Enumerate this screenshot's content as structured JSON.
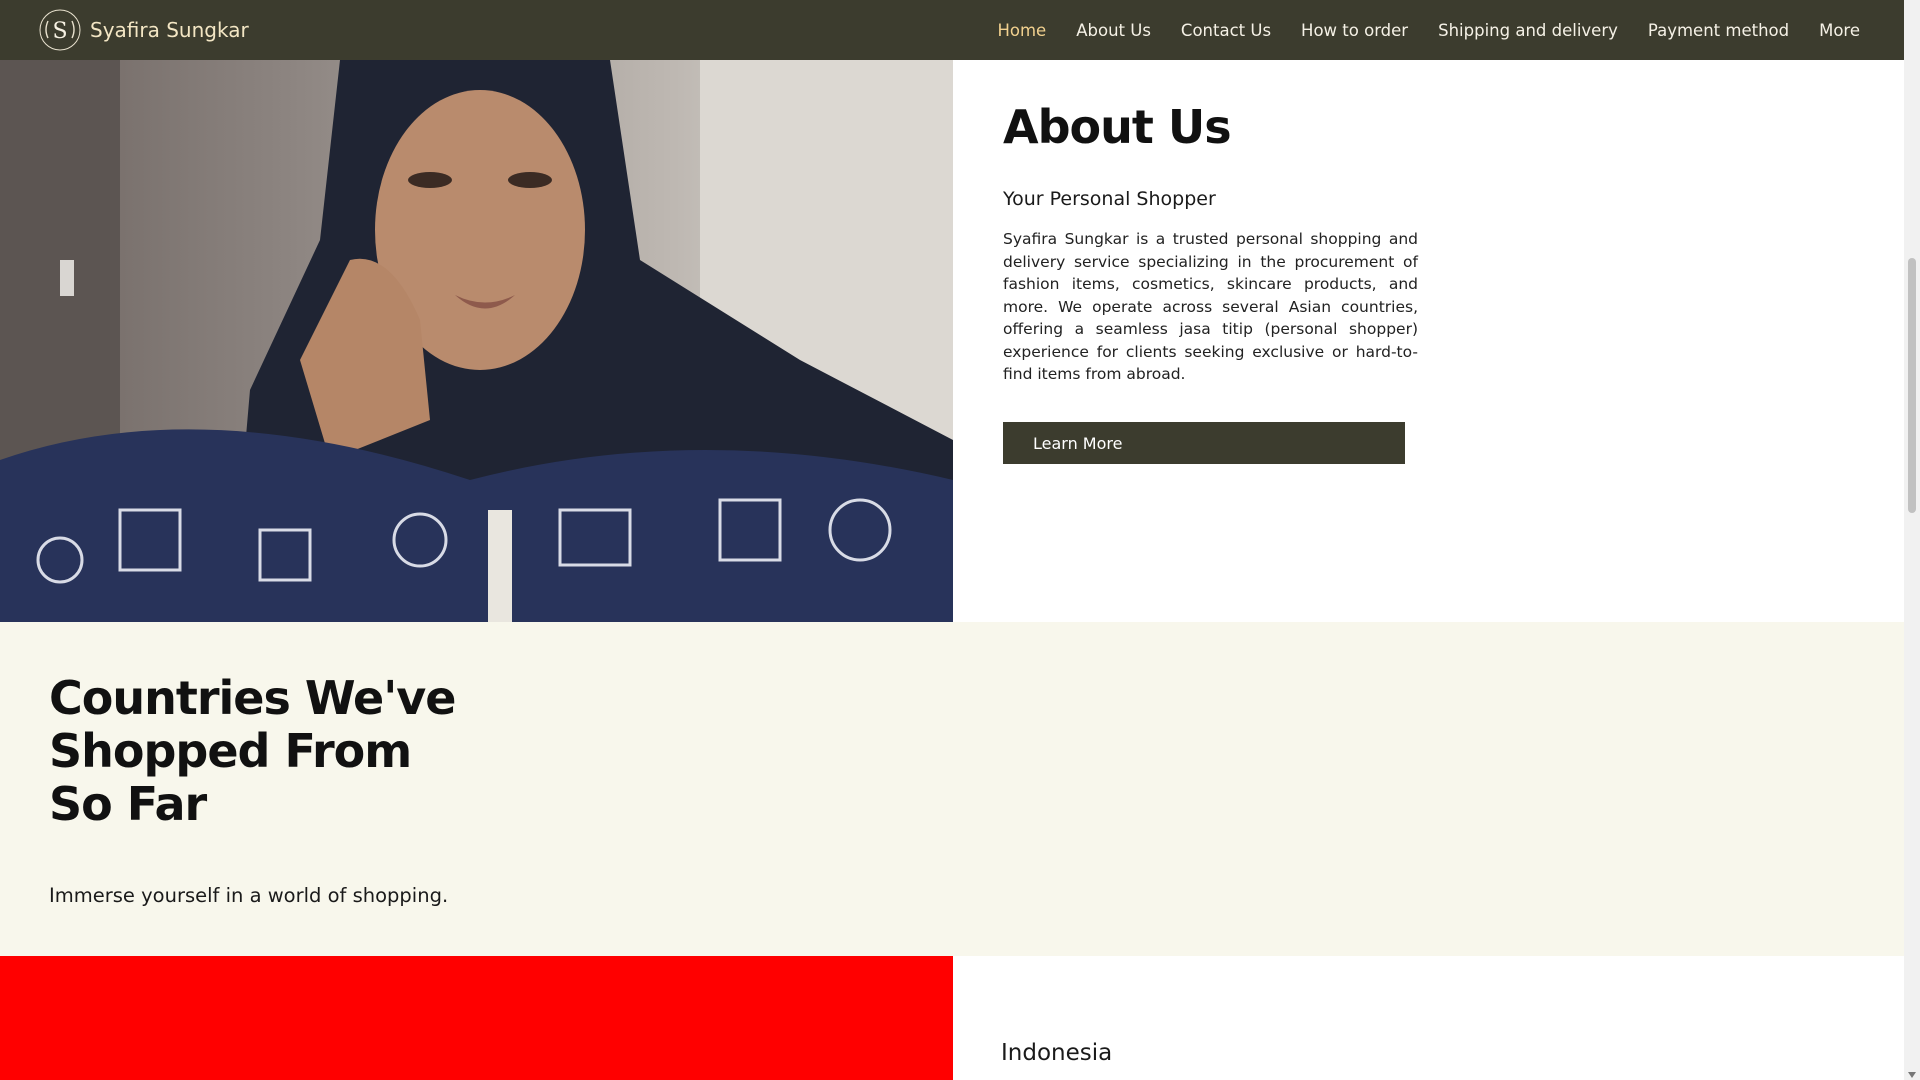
{
  "header": {
    "brand_name": "Syafira Sungkar",
    "nav": [
      {
        "label": "Home",
        "active": true
      },
      {
        "label": "About Us"
      },
      {
        "label": "Contact Us"
      },
      {
        "label": "How to order"
      },
      {
        "label": "Shipping and delivery"
      },
      {
        "label": "Payment method"
      },
      {
        "label": "More"
      }
    ]
  },
  "about": {
    "title": "About Us",
    "subtitle": "Your Personal Shopper",
    "body": "Syafira Sungkar is a trusted personal shopping and delivery service specializing in the procurement of fashion items, cosmetics, skincare products, and more. We operate across several Asian countries, offering a seamless jasa titip (personal shopper) experience for clients seeking exclusive or hard-to-find items from abroad.",
    "button_label": "Learn More"
  },
  "countries": {
    "title_lines": [
      "Countries We've",
      "Shopped From",
      "So Far"
    ],
    "subtitle": "Immerse yourself in a world of shopping.",
    "items": [
      {
        "name": "Indonesia"
      }
    ]
  },
  "colors": {
    "header_bg": "#3c3c2e",
    "brand_text": "#f3e6c4",
    "nav_active": "#f2d18f",
    "section_bg": "#f8f7ec",
    "button_bg": "#3c3c2e",
    "flag_red": "#ff0000"
  },
  "icons": {
    "brand_logo": "s-monogram-wreath-logo"
  }
}
